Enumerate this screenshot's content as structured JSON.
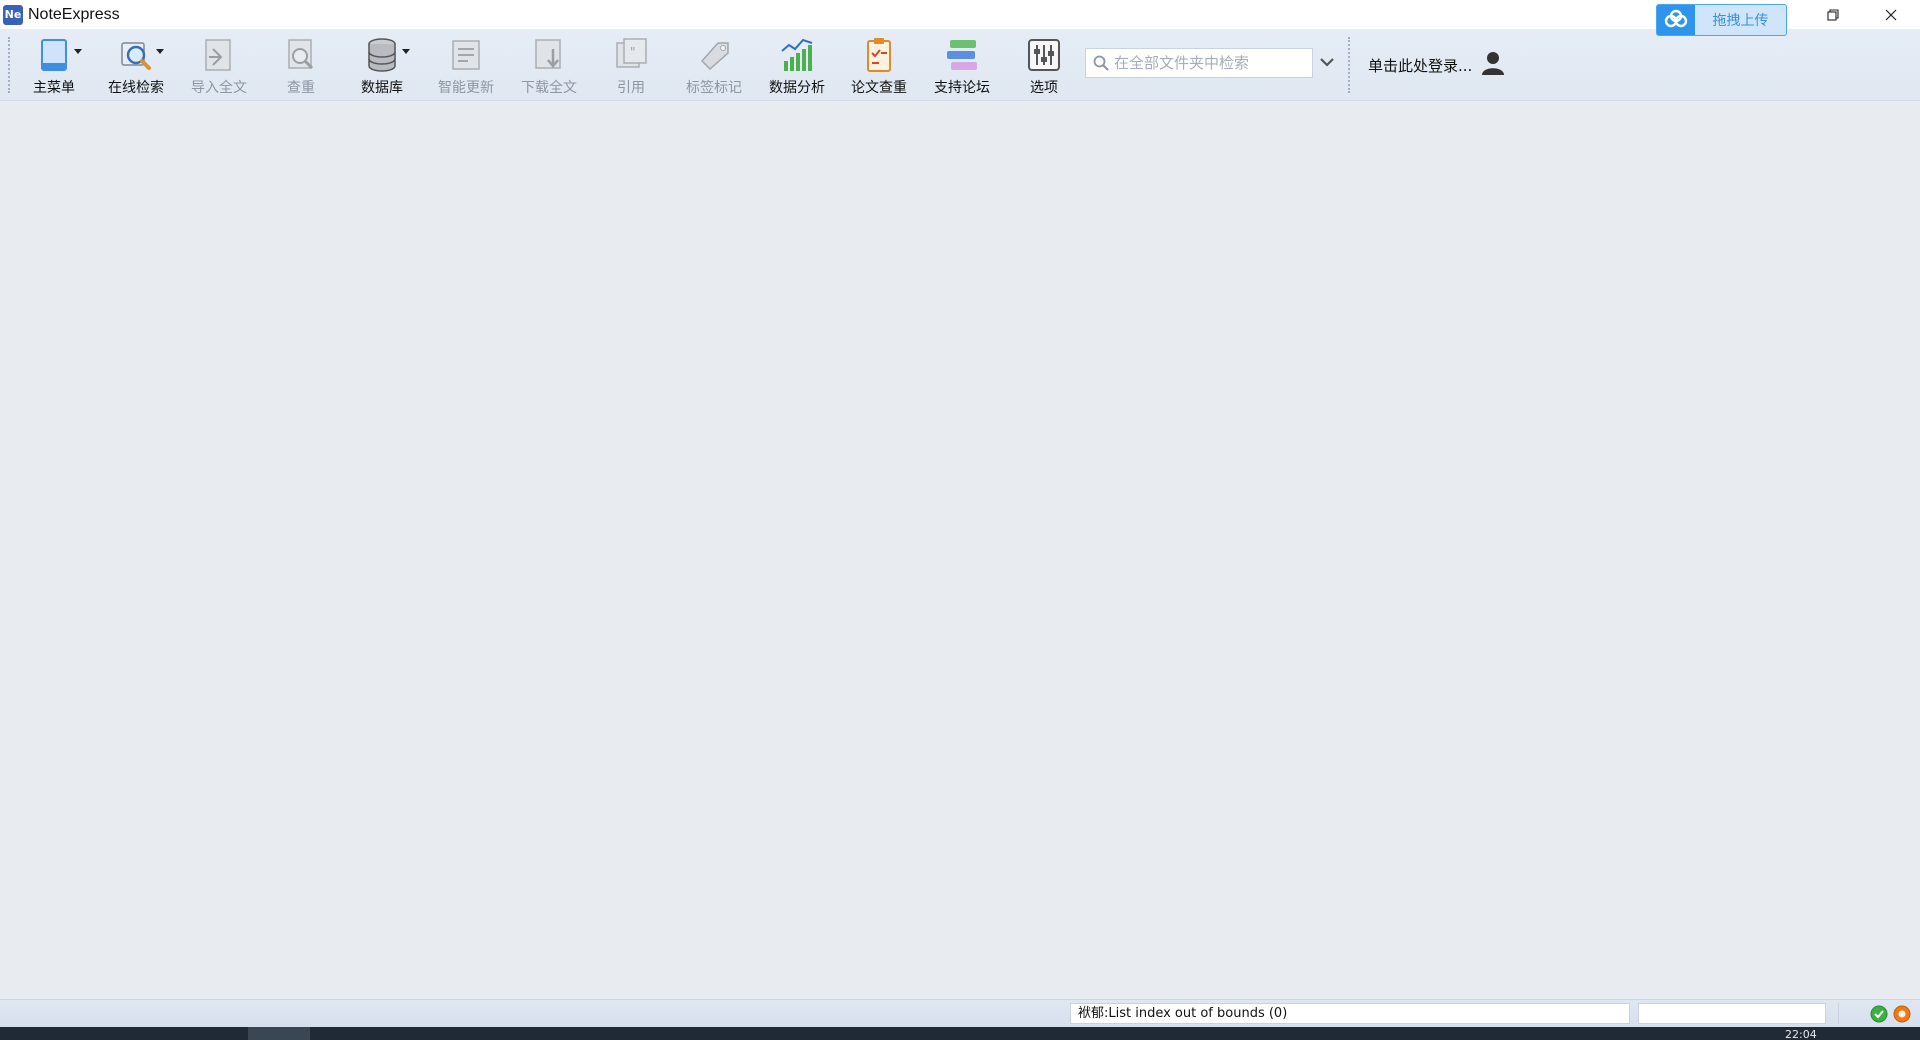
{
  "window": {
    "title": "NoteExpress",
    "logo_text": "Ne"
  },
  "toolbar": {
    "buttons": [
      {
        "label": "主菜单",
        "icon": "main-menu-icon",
        "enabled": true,
        "dropdown": true
      },
      {
        "label": "在线检索",
        "icon": "online-search-icon",
        "enabled": true,
        "dropdown": true
      },
      {
        "label": "导入全文",
        "icon": "import-fulltext-icon",
        "enabled": false
      },
      {
        "label": "查重",
        "icon": "duplicate-check-icon",
        "enabled": false
      },
      {
        "label": "数据库",
        "icon": "database-icon",
        "enabled": true,
        "dropdown": true
      },
      {
        "label": "智能更新",
        "icon": "smart-update-icon",
        "enabled": false
      },
      {
        "label": "下载全文",
        "icon": "download-fulltext-icon",
        "enabled": false
      },
      {
        "label": "引用",
        "icon": "cite-icon",
        "enabled": false
      },
      {
        "label": "标签标记",
        "icon": "tag-icon",
        "enabled": false
      },
      {
        "label": "数据分析",
        "icon": "data-analysis-icon",
        "enabled": true
      },
      {
        "label": "论文查重",
        "icon": "paper-check-icon",
        "enabled": true
      },
      {
        "label": "支持论坛",
        "icon": "forum-icon",
        "enabled": true
      },
      {
        "label": "选项",
        "icon": "options-icon",
        "enabled": true
      }
    ],
    "search": {
      "placeholder": "在全部文件夹中检索",
      "value": ""
    },
    "login_label": "单击此处登录...",
    "upload_label": "拖拽上传"
  },
  "statusbar": {
    "message": "袱郁:List index out of bounds (0)",
    "field_value": ""
  },
  "taskbar": {
    "clock": "22:04"
  },
  "colors": {
    "accent": "#2f95ec",
    "toolbar_bg": "#e2e9f3",
    "workspace_bg": "#e8ecf1",
    "status_ok": "#3cb043",
    "status_warn": "#f07a1a"
  }
}
